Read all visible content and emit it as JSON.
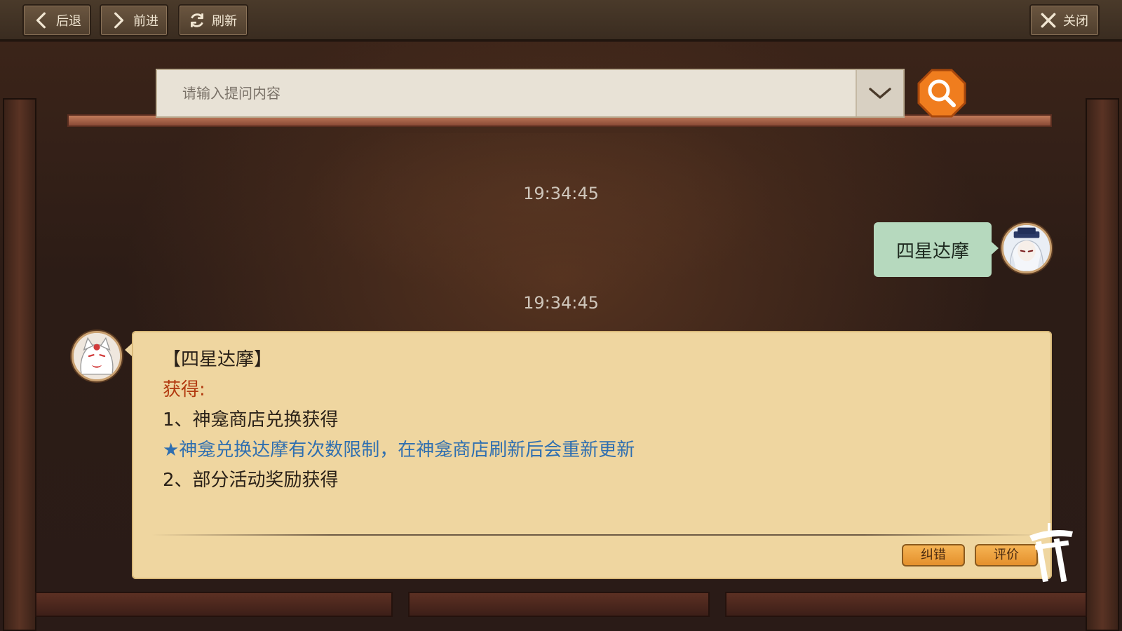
{
  "nav": {
    "back_label": "后退",
    "forward_label": "前进",
    "refresh_label": "刷新",
    "close_label": "关闭"
  },
  "search": {
    "placeholder": "请输入提问内容",
    "value": ""
  },
  "chat": {
    "timestamp_1": "19:34:45",
    "user_message": "四星达摩",
    "timestamp_2": "19:34:45",
    "answer": {
      "title": "【四星达摩】",
      "obtain_label": "获得:",
      "line_1": "1、神龛商店兑换获得",
      "note": "★神龛兑换达摩有次数限制，在神龛商店刷新后会重新更新",
      "line_2": "2、部分活动奖励获得",
      "report_label": "纠错",
      "rate_label": "评价"
    }
  },
  "colors": {
    "user_bubble": "#b6d9be",
    "answer_card": "#efd6a0",
    "obtain_text": "#b23a10",
    "note_text": "#2f6fb0",
    "search_button": "#f07d1e"
  },
  "icons": {
    "back": "chevron-left-icon",
    "forward": "chevron-right-icon",
    "refresh": "refresh-icon",
    "close": "close-icon",
    "dropdown": "chevron-down-icon",
    "search": "search-icon",
    "torii": "torii-gate-icon"
  }
}
